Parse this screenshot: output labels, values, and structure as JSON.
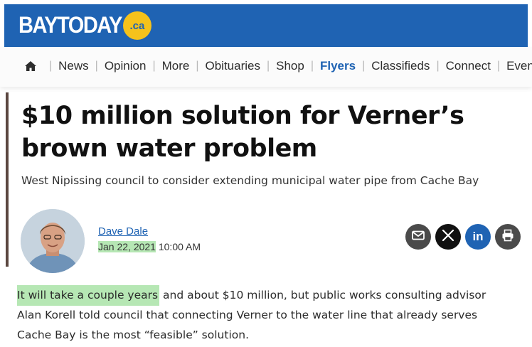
{
  "header": {
    "logo_text": "BAYTODAY",
    "logo_badge": ".ca",
    "brand_color": "#1f63b3",
    "badge_color": "#f5c21b"
  },
  "nav": {
    "home_icon": "home-icon",
    "items": [
      "News",
      "Opinion",
      "More",
      "Obituaries",
      "Shop",
      "Flyers",
      "Classifieds",
      "Connect",
      "Events"
    ],
    "active": "Flyers"
  },
  "article": {
    "headline_line1": "$10 million solution for Verner’s",
    "headline_line2": "brown water problem",
    "subhead": "West Nipissing council to consider extending municipal water pipe from Cache Bay",
    "author": "Dave Dale",
    "date": "Jan 22, 2021",
    "time": "10:00 AM",
    "highlight_color": "#b6e7b4",
    "body_highlight": "It will take a couple years",
    "body_rest_line1": " and about $10 million, but public works consulting advisor",
    "body_line2": "Alan Korell told council that connecting Verner to the water line that already serves",
    "body_line3": "Cache Bay is the most “feasible” solution."
  },
  "share": {
    "icons": [
      "email-icon",
      "x-icon",
      "linkedin-icon",
      "print-icon"
    ],
    "linkedin_label": "in"
  }
}
